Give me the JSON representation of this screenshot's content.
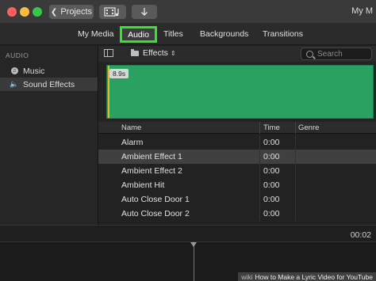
{
  "titlebar": {
    "projects_label": "Projects",
    "window_title": "My M"
  },
  "tabs": [
    {
      "label": "My Media"
    },
    {
      "label": "Audio"
    },
    {
      "label": "Titles"
    },
    {
      "label": "Backgrounds"
    },
    {
      "label": "Transitions"
    }
  ],
  "sidebar": {
    "heading": "AUDIO",
    "items": [
      {
        "label": "Music"
      },
      {
        "label": "Sound Effects"
      }
    ]
  },
  "browser": {
    "category": "Effects",
    "search_placeholder": "Search"
  },
  "preview": {
    "duration": "8.9s"
  },
  "list": {
    "columns": [
      "Name",
      "Time",
      "Genre"
    ],
    "rows": [
      {
        "name": "Alarm",
        "time": "0:00"
      },
      {
        "name": "Ambient Effect 1",
        "time": "0:00"
      },
      {
        "name": "Ambient Effect 2",
        "time": "0:00"
      },
      {
        "name": "Ambient Hit",
        "time": "0:00"
      },
      {
        "name": "Auto Close Door 1",
        "time": "0:00"
      },
      {
        "name": "Auto Close Door 2",
        "time": "0:00"
      }
    ]
  },
  "timeline": {
    "timecode": "00:02"
  },
  "watermark": {
    "text": "How to Make a Lyric Video for YouTube",
    "logo": "wiki"
  },
  "colors": {
    "highlight": "#33e62c",
    "waveform": "#2aa061",
    "playhead": "#e8b62b"
  }
}
